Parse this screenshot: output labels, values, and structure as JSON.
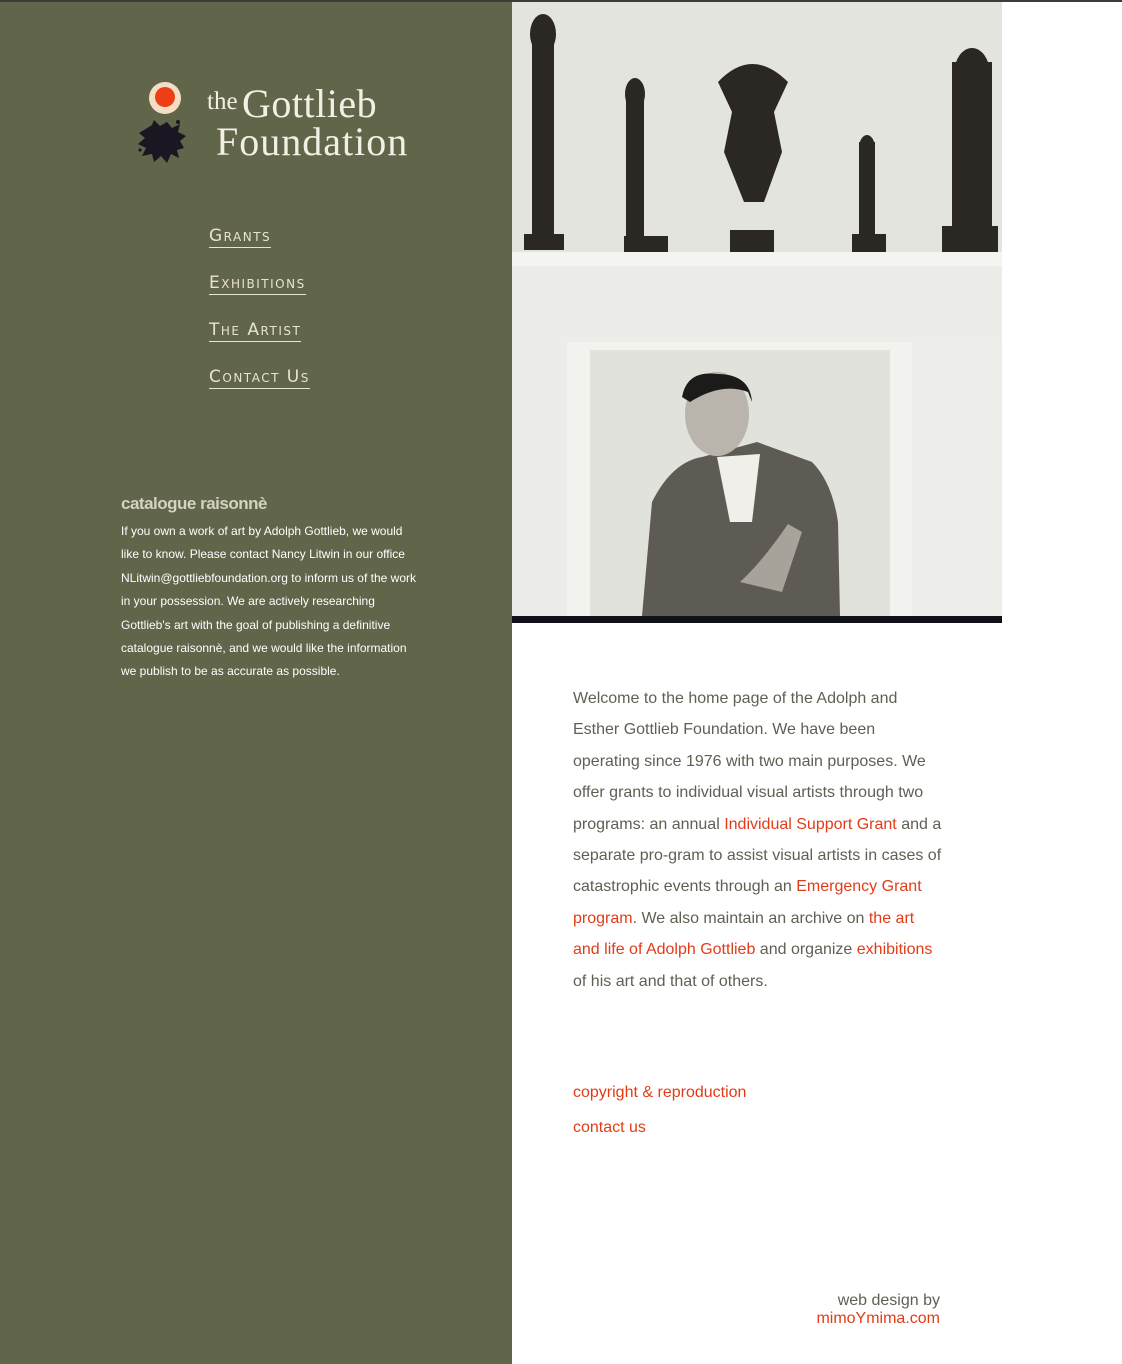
{
  "logo": {
    "the": "the",
    "name": "Gottlieb",
    "foundation": "Foundation",
    "mark_icon": "red-dot-black-splash-icon"
  },
  "nav": {
    "items": [
      {
        "label": "Grants"
      },
      {
        "label": "Exhibitions"
      },
      {
        "label": "The Artist"
      },
      {
        "label": "Contact Us"
      }
    ]
  },
  "catalogue": {
    "title": "catalogue raisonnè",
    "body": "If you own a work of art by Adolph Gottlieb, we would like to know. Please contact Nancy Litwin in our office NLitwin@gottliebfoundation.org  to inform us of the work in your possession. We are actively researching Gottlieb's art with the goal of publishing a definitive catalogue raisonnè, and we would like the information we publish to be as accurate as possible."
  },
  "welcome": {
    "p1": "Welcome to the home page of the Adolph and Esther Gottlieb Foundation. We have been operating since 1976 with two main purposes. We offer grants to individual visual artists through two programs: an annual ",
    "link1": "Individual Support Grant",
    "p2": " and a separate pro-gram to assist visual artists in cases of catastrophic events through an ",
    "link2": "Emergency Grant program",
    "p3": ". We also maintain an archive on ",
    "link3": "the art and life of Adolph Gottlieb",
    "p4": " and organize ",
    "link4": "exhibitions",
    "p5": " of his art and that of others."
  },
  "footer": {
    "copyright": "copyright & reproduction",
    "contact": "contact us",
    "credit_label": "web design by",
    "credit_link": "mimoYmima.com"
  },
  "colors": {
    "sidebar": "#616549",
    "accent": "#e23c17",
    "body_text": "#5f5f52",
    "nav_text": "#e9e4cf"
  }
}
